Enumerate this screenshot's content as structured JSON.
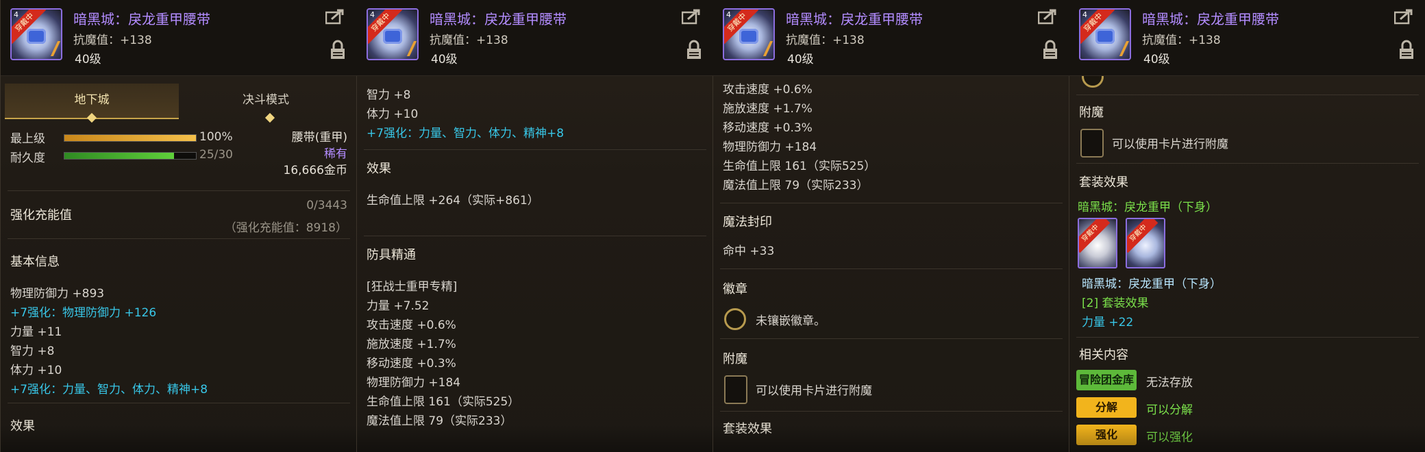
{
  "item": {
    "name": "暗黑城：戾龙重甲腰带",
    "stat": "抗魔值：+138",
    "level": "40级",
    "badge": "穿戴中",
    "level_num": "4"
  },
  "panel1": {
    "tabs": [
      "地下城",
      "决斗模式"
    ],
    "grade_label": "最上级",
    "grade_value": "100%",
    "grade_fraction": 1.0,
    "durability_label": "耐久度",
    "durability_value": "25/30",
    "durability_fraction": 0.833,
    "type": "腰带(重甲)",
    "rarity": "稀有",
    "price": "16,666金币",
    "charge_label": "强化充能值",
    "charge_value": "0/3443",
    "charge_note": "（强化充能值：8918）",
    "basic_title": "基本信息",
    "lines": [
      "物理防御力 +893",
      "+7强化：物理防御力 +126",
      "力量 +11",
      "智力 +8",
      "体力 +10",
      "+7强化：力量、智力、体力、精神+8"
    ],
    "effect_title": "效果"
  },
  "panel2": {
    "lines_top": [
      "智力 +8",
      "体力 +10",
      "+7强化：力量、智力、体力、精神+8"
    ],
    "effect_title": "效果",
    "effect_line": "生命值上限 +264（实际+861）",
    "mastery_title": "防具精通",
    "mastery_lines": [
      "[狂战士重甲专精]",
      "力量 +7.52",
      "攻击速度 +0.6%",
      "施放速度 +1.7%",
      "移动速度 +0.3%",
      "物理防御力 +184",
      "生命值上限 161（实际525）",
      "魔法值上限 79（实际233）"
    ]
  },
  "panel3": {
    "lines_top": [
      "攻击速度 +0.6%",
      "施放速度 +1.7%",
      "移动速度 +0.3%",
      "物理防御力 +184",
      "生命值上限 161（实际525）",
      "魔法值上限 79（实际233）"
    ],
    "seal_title": "魔法封印",
    "seal_line": "命中 +33",
    "emblem_title": "徽章",
    "emblem_line": "未镶嵌徽章。",
    "enchant_title": "附魔",
    "enchant_line": "可以使用卡片进行附魔",
    "set_title": "套装效果"
  },
  "panel4": {
    "enchant_title": "附魔",
    "enchant_line": "可以使用卡片进行附魔",
    "set_title": "套装效果",
    "set_name": "暗黑城：戾龙重甲（下身）",
    "set_item": "暗黑城：戾龙重甲（下身）",
    "set_count": "[2] 套装效果",
    "set_bonus": "力量 +22",
    "related_title": "相关内容",
    "related": [
      {
        "button": "冒险团金库",
        "text": "无法存放"
      },
      {
        "button": "分解",
        "text": "可以分解"
      },
      {
        "button": "强化",
        "text": "可以强化"
      }
    ]
  },
  "colors": {
    "item_name": "#b38cff",
    "enhance_blue": "#38c7e8",
    "set_green": "#7be14b",
    "button_green": "#5db93a",
    "button_yellow": "#f2b41c"
  }
}
